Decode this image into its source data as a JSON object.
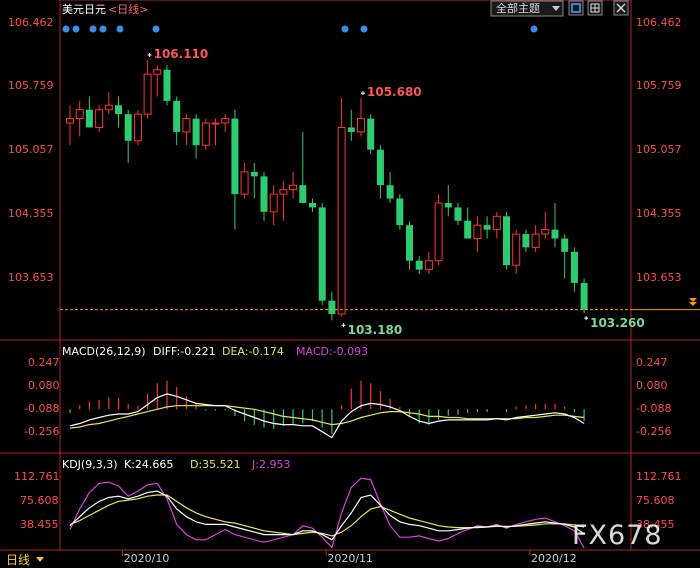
{
  "window": {
    "title": "美元日元",
    "period_label": "<日线>",
    "theme_label": "全部主题",
    "bottom_tab": "日线"
  },
  "colors": {
    "up": "#ff3333",
    "down": "#2ecc71",
    "price_axis": "#ff4d4d",
    "white_line": "#ffffff",
    "yellow_line": "#e6e65c",
    "magenta_line": "#e040e0",
    "marker": "#3a8ee6",
    "last_price_line": "#ff9900"
  },
  "icons": [
    "theme-dropdown-icon",
    "window-mode-icon",
    "window-restore-icon",
    "window-close-icon",
    "chevron-down-icon"
  ],
  "watermark": "FX678",
  "chart_data": [
    {
      "type": "candlestick",
      "yticks": [
        "106.462",
        "105.759",
        "105.057",
        "104.355",
        "103.653"
      ],
      "ylim": [
        103.16,
        106.56
      ],
      "x_labels": [
        {
          "label": "2020/10",
          "index": 4
        },
        {
          "label": "2020/11",
          "index": 25
        },
        {
          "label": "2020/12",
          "index": 46
        }
      ],
      "annotations": [
        {
          "text": "106.110",
          "index": 8,
          "value": 106.11,
          "position": "above",
          "color": "#ff5555"
        },
        {
          "text": "105.680",
          "index": 30,
          "value": 105.68,
          "position": "above",
          "color": "#ff5555"
        },
        {
          "text": "103.180",
          "index": 28,
          "value": 103.18,
          "position": "below",
          "color": "#7cd992"
        },
        {
          "text": "103.260",
          "index": 53,
          "value": 103.26,
          "position": "below",
          "color": "#7cd992"
        }
      ],
      "last_price": 103.3,
      "candles": [
        {
          "o": 105.4,
          "h": 105.6,
          "l": 105.15,
          "c": 105.45
        },
        {
          "o": 105.45,
          "h": 105.65,
          "l": 105.25,
          "c": 105.55
        },
        {
          "o": 105.55,
          "h": 105.7,
          "l": 105.4,
          "c": 105.35
        },
        {
          "o": 105.35,
          "h": 105.6,
          "l": 105.3,
          "c": 105.55
        },
        {
          "o": 105.55,
          "h": 105.75,
          "l": 105.5,
          "c": 105.6
        },
        {
          "o": 105.6,
          "h": 105.7,
          "l": 105.35,
          "c": 105.5
        },
        {
          "o": 105.5,
          "h": 105.55,
          "l": 104.95,
          "c": 105.2
        },
        {
          "o": 105.2,
          "h": 105.55,
          "l": 105.15,
          "c": 105.5
        },
        {
          "o": 105.5,
          "h": 106.11,
          "l": 105.45,
          "c": 105.95
        },
        {
          "o": 105.95,
          "h": 106.05,
          "l": 105.7,
          "c": 106.0
        },
        {
          "o": 106.0,
          "h": 106.05,
          "l": 105.6,
          "c": 105.65
        },
        {
          "o": 105.65,
          "h": 105.7,
          "l": 105.15,
          "c": 105.3
        },
        {
          "o": 105.3,
          "h": 105.5,
          "l": 105.15,
          "c": 105.45
        },
        {
          "o": 105.45,
          "h": 105.5,
          "l": 105.0,
          "c": 105.15
        },
        {
          "o": 105.15,
          "h": 105.45,
          "l": 105.1,
          "c": 105.4
        },
        {
          "o": 105.4,
          "h": 105.45,
          "l": 105.15,
          "c": 105.4
        },
        {
          "o": 105.4,
          "h": 105.5,
          "l": 105.3,
          "c": 105.45
        },
        {
          "o": 105.45,
          "h": 105.55,
          "l": 104.2,
          "c": 104.6
        },
        {
          "o": 104.6,
          "h": 104.95,
          "l": 104.55,
          "c": 104.85
        },
        {
          "o": 104.85,
          "h": 104.95,
          "l": 104.55,
          "c": 104.8
        },
        {
          "o": 104.8,
          "h": 104.85,
          "l": 104.3,
          "c": 104.4
        },
        {
          "o": 104.4,
          "h": 104.7,
          "l": 104.25,
          "c": 104.6
        },
        {
          "o": 104.6,
          "h": 104.75,
          "l": 104.3,
          "c": 104.65
        },
        {
          "o": 104.65,
          "h": 104.85,
          "l": 104.55,
          "c": 104.7
        },
        {
          "o": 104.7,
          "h": 105.3,
          "l": 104.5,
          "c": 104.5
        },
        {
          "o": 104.5,
          "h": 104.55,
          "l": 104.4,
          "c": 104.45
        },
        {
          "o": 104.45,
          "h": 104.5,
          "l": 103.35,
          "c": 103.4
        },
        {
          "o": 103.4,
          "h": 103.5,
          "l": 103.18,
          "c": 103.25
        },
        {
          "o": 103.25,
          "h": 105.68,
          "l": 103.22,
          "c": 105.35
        },
        {
          "o": 105.35,
          "h": 105.55,
          "l": 105.2,
          "c": 105.3
        },
        {
          "o": 105.3,
          "h": 105.68,
          "l": 105.25,
          "c": 105.45
        },
        {
          "o": 105.45,
          "h": 105.5,
          "l": 105.05,
          "c": 105.1
        },
        {
          "o": 105.1,
          "h": 105.15,
          "l": 104.55,
          "c": 104.7
        },
        {
          "o": 104.7,
          "h": 104.85,
          "l": 104.5,
          "c": 104.55
        },
        {
          "o": 104.55,
          "h": 104.6,
          "l": 104.2,
          "c": 104.25
        },
        {
          "o": 104.25,
          "h": 104.3,
          "l": 103.75,
          "c": 103.85
        },
        {
          "o": 103.85,
          "h": 103.9,
          "l": 103.7,
          "c": 103.75
        },
        {
          "o": 103.75,
          "h": 103.95,
          "l": 103.7,
          "c": 103.85
        },
        {
          "o": 103.85,
          "h": 104.6,
          "l": 103.8,
          "c": 104.5
        },
        {
          "o": 104.5,
          "h": 104.7,
          "l": 104.35,
          "c": 104.45
        },
        {
          "o": 104.45,
          "h": 104.5,
          "l": 104.25,
          "c": 104.3
        },
        {
          "o": 104.3,
          "h": 104.45,
          "l": 104.1,
          "c": 104.1
        },
        {
          "o": 104.1,
          "h": 104.35,
          "l": 103.95,
          "c": 104.25
        },
        {
          "o": 104.25,
          "h": 104.35,
          "l": 104.1,
          "c": 104.2
        },
        {
          "o": 104.2,
          "h": 104.4,
          "l": 104.1,
          "c": 104.35
        },
        {
          "o": 104.35,
          "h": 104.4,
          "l": 103.75,
          "c": 103.8
        },
        {
          "o": 103.8,
          "h": 104.2,
          "l": 103.7,
          "c": 104.15
        },
        {
          "o": 104.15,
          "h": 104.2,
          "l": 103.95,
          "c": 104.0
        },
        {
          "o": 104.0,
          "h": 104.25,
          "l": 103.95,
          "c": 104.15
        },
        {
          "o": 104.15,
          "h": 104.4,
          "l": 104.1,
          "c": 104.2
        },
        {
          "o": 104.2,
          "h": 104.5,
          "l": 104.0,
          "c": 104.1
        },
        {
          "o": 104.1,
          "h": 104.15,
          "l": 103.65,
          "c": 103.95
        },
        {
          "o": 103.95,
          "h": 104.0,
          "l": 103.5,
          "c": 103.6
        },
        {
          "o": 103.6,
          "h": 103.65,
          "l": 103.26,
          "c": 103.3
        }
      ]
    },
    {
      "type": "macd",
      "title": "MACD(26,12,9)",
      "readouts": [
        {
          "text": "DIFF:-0.221",
          "color": "#ffffff"
        },
        {
          "text": "DEA:-0.174",
          "color": "#e6e65c"
        },
        {
          "text": "MACD:-0.093",
          "color": "#e040e0"
        }
      ],
      "yticks": [
        "0.247",
        "0.080",
        "-0.088",
        "-0.256"
      ],
      "ylim": [
        -0.36,
        0.3
      ],
      "diff": [
        -0.24,
        -0.22,
        -0.19,
        -0.17,
        -0.15,
        -0.14,
        -0.14,
        -0.12,
        -0.06,
        0.0,
        0.03,
        0.01,
        -0.02,
        -0.05,
        -0.06,
        -0.07,
        -0.07,
        -0.11,
        -0.14,
        -0.17,
        -0.2,
        -0.22,
        -0.23,
        -0.23,
        -0.24,
        -0.24,
        -0.29,
        -0.34,
        -0.2,
        -0.12,
        -0.07,
        -0.05,
        -0.06,
        -0.08,
        -0.11,
        -0.16,
        -0.2,
        -0.22,
        -0.2,
        -0.19,
        -0.19,
        -0.19,
        -0.19,
        -0.19,
        -0.18,
        -0.19,
        -0.17,
        -0.16,
        -0.15,
        -0.14,
        -0.13,
        -0.14,
        -0.17,
        -0.22
      ],
      "dea": [
        -0.26,
        -0.25,
        -0.23,
        -0.22,
        -0.2,
        -0.18,
        -0.16,
        -0.14,
        -0.12,
        -0.1,
        -0.08,
        -0.07,
        -0.07,
        -0.07,
        -0.07,
        -0.07,
        -0.07,
        -0.08,
        -0.09,
        -0.1,
        -0.12,
        -0.14,
        -0.16,
        -0.17,
        -0.18,
        -0.19,
        -0.21,
        -0.23,
        -0.22,
        -0.2,
        -0.17,
        -0.15,
        -0.13,
        -0.12,
        -0.12,
        -0.13,
        -0.14,
        -0.16,
        -0.16,
        -0.17,
        -0.17,
        -0.18,
        -0.18,
        -0.18,
        -0.18,
        -0.18,
        -0.18,
        -0.17,
        -0.17,
        -0.16,
        -0.15,
        -0.15,
        -0.16,
        -0.17
      ],
      "hist": [
        -0.03,
        0.03,
        0.06,
        0.07,
        0.09,
        0.09,
        0.04,
        0.03,
        0.12,
        0.2,
        0.22,
        0.17,
        0.1,
        0.04,
        -0.01,
        -0.01,
        -0.01,
        -0.05,
        -0.09,
        -0.12,
        -0.14,
        -0.15,
        -0.13,
        -0.12,
        -0.11,
        -0.09,
        -0.14,
        -0.19,
        0.03,
        0.16,
        0.22,
        0.2,
        0.14,
        0.08,
        0.02,
        -0.05,
        -0.11,
        -0.12,
        -0.08,
        -0.05,
        -0.04,
        -0.03,
        -0.02,
        -0.02,
        0.0,
        -0.02,
        0.02,
        0.03,
        0.04,
        0.04,
        0.04,
        0.02,
        -0.02,
        -0.09
      ]
    },
    {
      "type": "kdj",
      "title": "KDJ(9,3,3)",
      "readouts": [
        {
          "text": "K:24.665",
          "color": "#ffffff"
        },
        {
          "text": "D:35.521",
          "color": "#e6e65c"
        },
        {
          "text": "J:2.953",
          "color": "#e040e0"
        }
      ],
      "yticks": [
        "112.761",
        "75.608",
        "38.455"
      ],
      "ylim": [
        0,
        125
      ],
      "k": [
        38,
        52,
        66,
        76,
        82,
        84,
        80,
        84,
        90,
        92,
        84,
        64,
        52,
        44,
        40,
        40,
        40,
        36,
        32,
        28,
        24,
        24,
        24,
        24,
        30,
        30,
        24,
        16,
        38,
        58,
        82,
        86,
        70,
        54,
        44,
        40,
        38,
        34,
        30,
        30,
        32,
        34,
        36,
        36,
        38,
        36,
        38,
        40,
        42,
        44,
        42,
        40,
        36,
        25
      ],
      "d": [
        40,
        46,
        54,
        62,
        70,
        76,
        78,
        80,
        84,
        86,
        86,
        76,
        66,
        58,
        52,
        48,
        44,
        42,
        38,
        34,
        30,
        28,
        26,
        24,
        26,
        28,
        26,
        22,
        28,
        38,
        52,
        64,
        68,
        62,
        56,
        50,
        46,
        42,
        38,
        36,
        35,
        35,
        35,
        36,
        37,
        37,
        37,
        38,
        39,
        41,
        41,
        41,
        39,
        36
      ],
      "j": [
        32,
        64,
        90,
        104,
        106,
        100,
        84,
        92,
        102,
        104,
        80,
        40,
        24,
        16,
        16,
        24,
        32,
        24,
        20,
        16,
        12,
        16,
        20,
        24,
        38,
        34,
        20,
        4,
        58,
        98,
        112,
        110,
        72,
        38,
        20,
        20,
        22,
        18,
        14,
        18,
        26,
        32,
        38,
        36,
        40,
        34,
        40,
        44,
        48,
        50,
        44,
        38,
        30,
        3
      ]
    }
  ]
}
